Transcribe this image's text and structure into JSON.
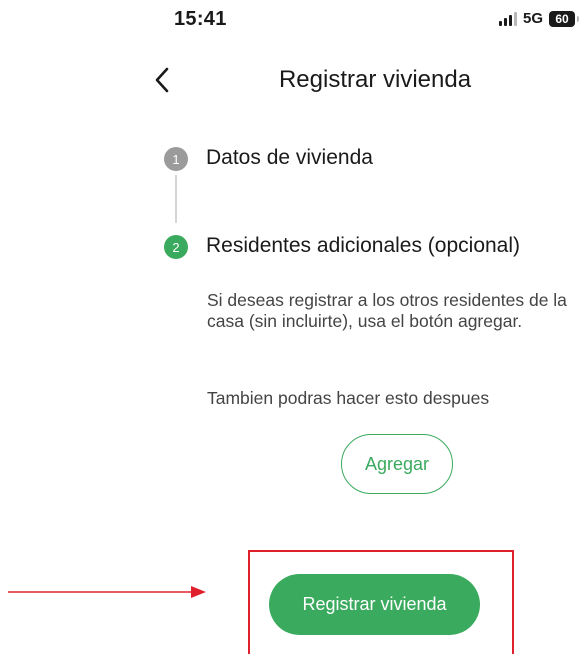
{
  "status_bar": {
    "time": "15:41",
    "network": "5G",
    "battery": "60"
  },
  "header": {
    "back_icon": "chevron-left-icon",
    "title": "Registrar vivienda"
  },
  "steps": [
    {
      "number": "1",
      "label": "Datos de vivienda",
      "state": "completed",
      "color": "#9b9b9b"
    },
    {
      "number": "2",
      "label": "Residentes adicionales (opcional)",
      "state": "active",
      "color": "#3aaa5e"
    }
  ],
  "content": {
    "description": "Si deseas registrar a los otros residentes de la casa (sin incluirte), usa el botón agregar.",
    "later_note": "Tambien podras hacer esto despues",
    "add_label": "Agregar",
    "register_label": "Registrar vivienda"
  },
  "colors": {
    "accent": "#3aaa5e",
    "annotation": "#e0202a",
    "inactive_step": "#9b9b9b"
  }
}
